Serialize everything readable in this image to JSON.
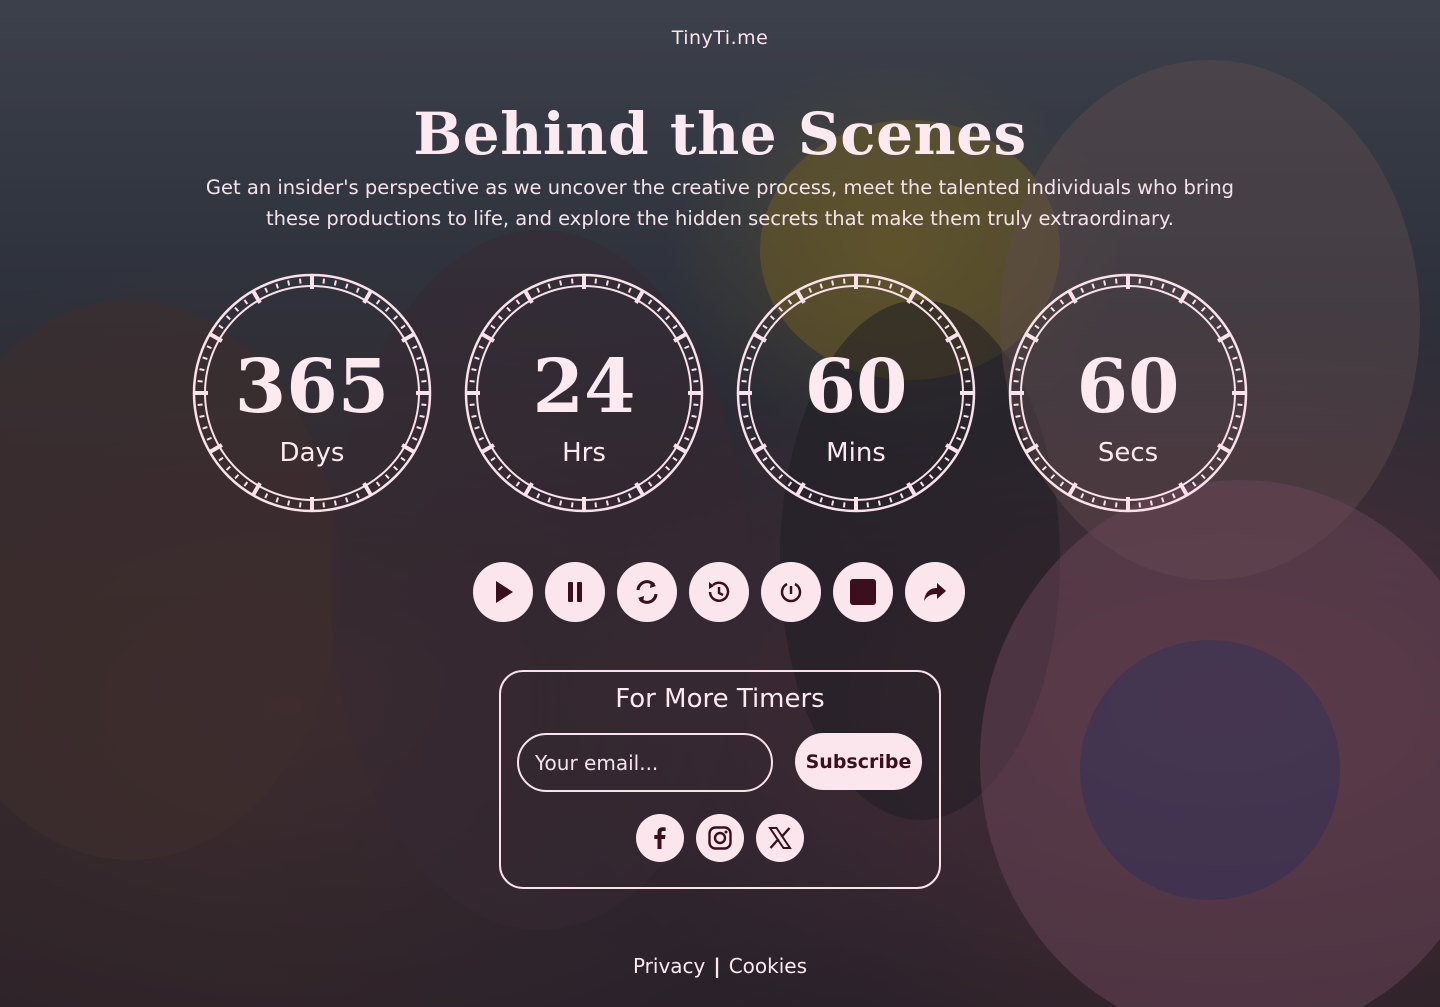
{
  "brand": "TinyTi.me",
  "hero": {
    "title": "Behind the Scenes",
    "subtitle": "Get an insider's perspective as we uncover the creative process, meet the talented individuals who bring these productions to life, and explore the hidden secrets that make them truly extraordinary."
  },
  "timers": [
    {
      "value": "365",
      "unit": "Days"
    },
    {
      "value": "24",
      "unit": "Hrs"
    },
    {
      "value": "60",
      "unit": "Mins"
    },
    {
      "value": "60",
      "unit": "Secs"
    }
  ],
  "controls": [
    {
      "name": "play",
      "icon": "play-icon"
    },
    {
      "name": "pause",
      "icon": "pause-icon"
    },
    {
      "name": "refresh",
      "icon": "refresh-icon"
    },
    {
      "name": "history",
      "icon": "history-icon"
    },
    {
      "name": "reset",
      "icon": "reset-icon"
    },
    {
      "name": "stop",
      "icon": "stop-icon"
    },
    {
      "name": "share",
      "icon": "share-icon"
    }
  ],
  "subscribe": {
    "title": "For More Timers",
    "email_placeholder": "Your email...",
    "button_label": "Subscribe"
  },
  "socials": [
    {
      "name": "facebook",
      "icon": "facebook-icon"
    },
    {
      "name": "instagram",
      "icon": "instagram-icon"
    },
    {
      "name": "x",
      "icon": "x-icon"
    }
  ],
  "footer": {
    "privacy": "Privacy",
    "separator": "|",
    "cookies": "Cookies"
  },
  "colors": {
    "accent": "#fce6ee",
    "icon_dark": "#3a0f1e"
  }
}
